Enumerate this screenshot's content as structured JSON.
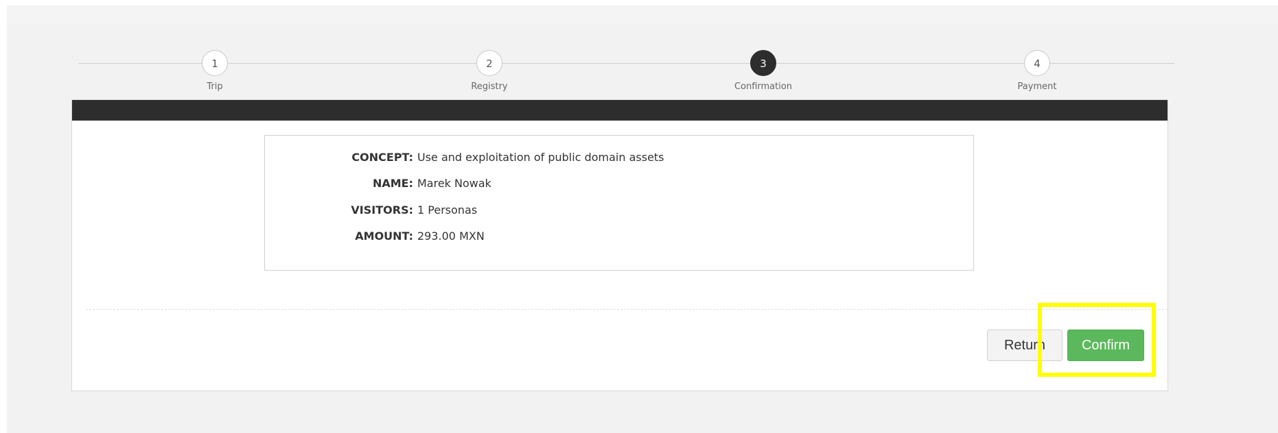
{
  "stepper": {
    "steps": [
      {
        "number": "1",
        "label": "Trip"
      },
      {
        "number": "2",
        "label": "Registry"
      },
      {
        "number": "3",
        "label": "Confirmation"
      },
      {
        "number": "4",
        "label": "Payment"
      }
    ],
    "active_step": 3
  },
  "summary": {
    "concept": {
      "label": "CONCEPT:",
      "value": "Use and exploitation of public domain assets"
    },
    "name": {
      "label": "NAME:",
      "value": "Marek Nowak"
    },
    "visitors": {
      "label": "VISITORS:",
      "value": "1 Personas"
    },
    "amount": {
      "label": "AMOUNT:",
      "value": "293.00 MXN"
    }
  },
  "actions": {
    "return_label": "Return",
    "confirm_label": "Confirm"
  },
  "colors": {
    "accent_dark": "#2d2d2d",
    "confirm_green": "#5cb85c",
    "highlight_yellow": "#ffff00"
  }
}
